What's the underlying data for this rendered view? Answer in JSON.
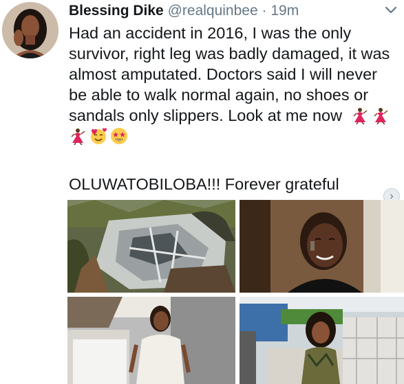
{
  "tweet": {
    "author_name": "Blessing Dike",
    "author_handle": "@realquinbee",
    "separator": "·",
    "timestamp": "19m",
    "text_lines": [
      "Had an accident in 2016, I was the only",
      "survivor, right leg was badly damaged, it was",
      "almost amputated. Doctors said I will never",
      "be able to walk normal again, no shoes or",
      "sandals only slippers. Look at me now"
    ],
    "emojis_inline": [
      "dancer-emoji",
      "dancer-emoji"
    ],
    "emojis_line2": [
      "dancer-emoji",
      "smiling-face-with-hearts-emoji",
      "star-struck-emoji"
    ],
    "closing_line": "OLUWATOBILOBA!!! Forever grateful",
    "more_indicator": "›"
  },
  "media": [
    {
      "name": "wrecked-vehicle-photo"
    },
    {
      "name": "injured-face-photo"
    },
    {
      "name": "woman-white-dress-photo"
    },
    {
      "name": "woman-outdoor-photo"
    }
  ],
  "colors": {
    "text": "#14171a",
    "secondary": "#657786",
    "background": "#ffffff"
  }
}
